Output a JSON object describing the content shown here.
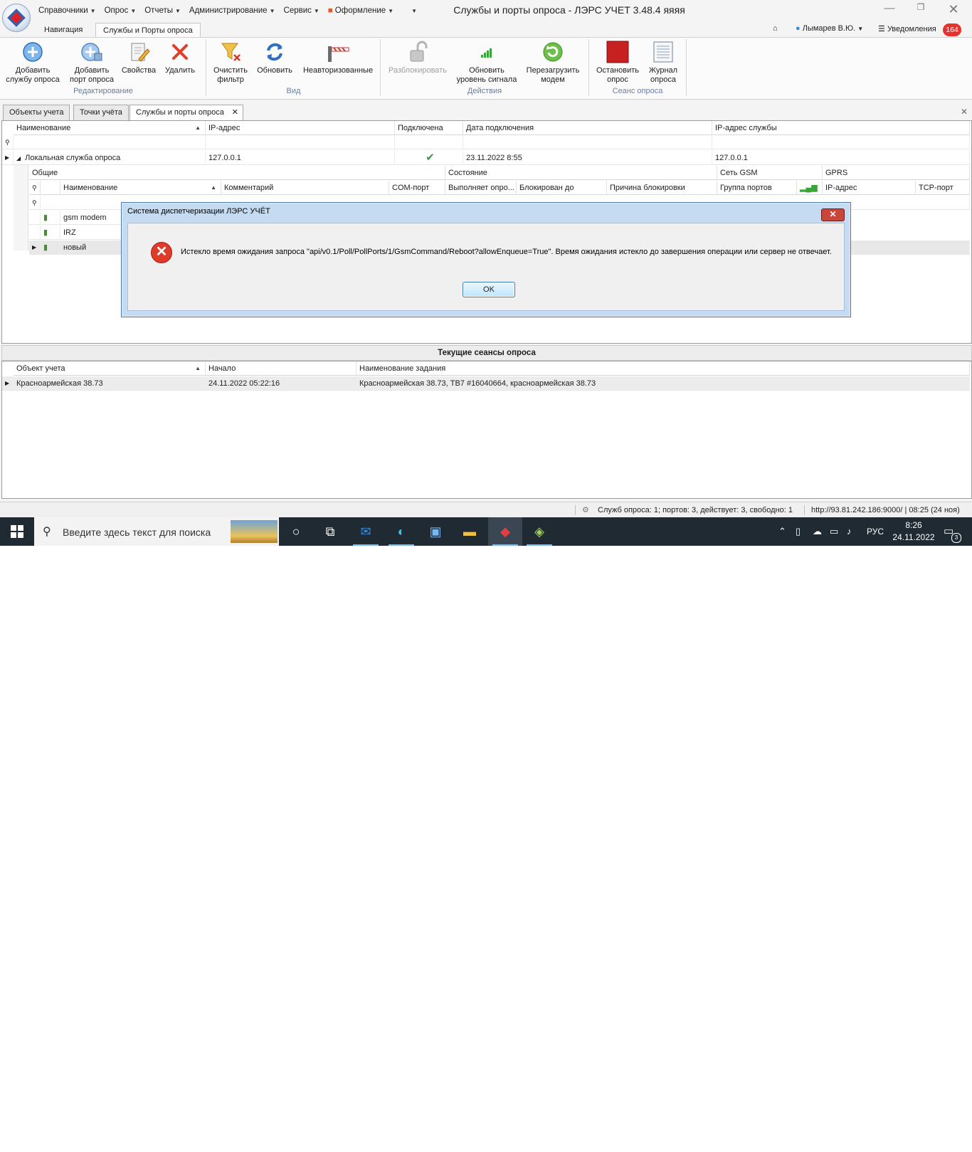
{
  "window": {
    "title": "Службы и порты опроса - ЛЭРС УЧЕТ 3.48.4 яяяя"
  },
  "menu": {
    "items": [
      "Справочники",
      "Опрос",
      "Отчеты",
      "Администрирование",
      "Сервис",
      "Оформление"
    ]
  },
  "ribbon_tabs": [
    "Навигация",
    "Службы и Порты опроса"
  ],
  "user": {
    "name": "Лымарев В.Ю.",
    "notifications_label": "Уведомления",
    "notifications_count": "164"
  },
  "ribbon": {
    "add_service": "Добавить\nслужбу опроса",
    "add_port": "Добавить\nпорт опроса",
    "properties": "Свойства",
    "delete": "Удалить",
    "group_edit": "Редактирование",
    "clear_filter": "Очистить\nфильтр",
    "refresh": "Обновить",
    "unauthorized": "Неавторизованные",
    "group_view": "Вид",
    "unlock": "Разблокировать",
    "update_signal": "Обновить\nуровень сигнала",
    "reboot_modem": "Перезагрузить\nмодем",
    "group_actions": "Действия",
    "stop_poll": "Остановить\nопрос",
    "poll_log": "Журнал\nопроса",
    "group_session": "Сеанс опроса"
  },
  "doc_tabs": [
    "Объекты учета",
    "Точки учёта",
    "Службы и порты опроса"
  ],
  "services_grid": {
    "columns": [
      "Наименование",
      "IP-адрес",
      "Подключена",
      "Дата подключения",
      "IP-адрес службы"
    ],
    "rows": [
      {
        "name": "Локальная служба опроса",
        "ip": "127.0.0.1",
        "connected": "✔",
        "date": "23.11.2022 8:55",
        "service_ip": "127.0.0.1"
      }
    ]
  },
  "ports_grid": {
    "band_headers": [
      "Общие",
      "Состояние",
      "Сеть GSM",
      "GPRS"
    ],
    "columns": [
      "Наименование",
      "Комментарий",
      "COM-порт",
      "Выполняет опро...",
      "Блокирован до",
      "Причина блокировки",
      "Группа портов",
      "IP-адрес",
      "TCP-порт"
    ],
    "rows": [
      "gsm modem",
      "IRZ",
      "новый"
    ]
  },
  "dialog": {
    "title": "Система диспетчеризации ЛЭРС УЧЁТ",
    "message": "Истекло время ожидания запроса \"api/v0.1/Poll/PollPorts/1/GsmCommand/Reboot?allowEnqueue=True\". Время ожидания истекло до завершения операции или сервер не отвечает.",
    "ok": "OK"
  },
  "sessions": {
    "title": "Текущие сеансы опроса",
    "columns": [
      "Объект учета",
      "Начало",
      "Наименование задания"
    ],
    "rows": [
      {
        "object": "Красноармейская 38.73",
        "start": "24.11.2022 05:22:16",
        "task": "Красноармейская 38.73, ТВ7 #16040664, красноармейская 38.73"
      }
    ]
  },
  "status_bar": {
    "summary": "Служб опроса: 1; портов: 3, действует: 3, свободно: 1",
    "server": "http://93.81.242.186:9000/ | 08:25 (24 ноя)"
  },
  "taskbar": {
    "search_placeholder": "Введите здесь текст для поиска",
    "language": "РУС",
    "time": "8:26",
    "date": "24.11.2022",
    "notification_count": "3"
  },
  "colors": {
    "accent_blue": "#2d63b5",
    "error_red": "#e03a2a",
    "notification_badge": "#e5322d",
    "stop_red": "#c62020"
  }
}
